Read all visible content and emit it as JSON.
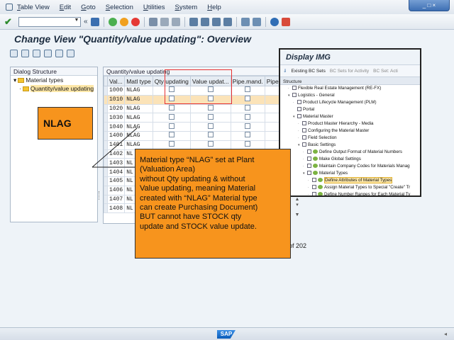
{
  "menu": [
    "Table View",
    "Edit",
    "Goto",
    "Selection",
    "Utilities",
    "System",
    "Help"
  ],
  "window_controls": "_ □ ×",
  "toolbar": {
    "back": "«",
    "dropdown": "▼"
  },
  "title": "Change View \"Quantity/value updating\": Overview",
  "dialog_structure": {
    "heading": "Dialog Structure",
    "items": [
      {
        "label": "Material types",
        "arrow": "▾"
      },
      {
        "label": "Quantity/value updating",
        "arrow": "·"
      }
    ]
  },
  "table": {
    "caption": "Quantity/value updating",
    "columns": [
      "Val...",
      "Matl type",
      "Qty updating",
      "Value updat...",
      "Pipe.mand.",
      "Pipe"
    ],
    "rows": [
      [
        "1000",
        "NLAG"
      ],
      [
        "1010",
        "NLAG"
      ],
      [
        "1020",
        "NLAG"
      ],
      [
        "1030",
        "NLAG"
      ],
      [
        "1040",
        "NLAG"
      ],
      [
        "1400",
        "NLAG"
      ],
      [
        "1401",
        "NLAG"
      ],
      [
        "1402",
        "NL"
      ],
      [
        "1403",
        "NL"
      ],
      [
        "1404",
        "NL"
      ],
      [
        "1405",
        "NL"
      ],
      [
        "1406",
        "NL"
      ],
      [
        "1407",
        "NL"
      ],
      [
        "1408",
        "NL"
      ]
    ],
    "highlight_row_index": 1,
    "count_text": "of 202"
  },
  "nlag_label": "NLAG",
  "callout": {
    "lines": [
      "Material type “NLAG” set at Plant",
      "(Valuation Area)",
      "without Qty updating & without",
      "Value updating, meaning Material",
      "created with “NLAG” Material type",
      "can create Purchasing Document)",
      "BUT cannot have STOCK qty",
      "update and STOCK value update."
    ]
  },
  "display_img": {
    "title": "Display IMG",
    "toolbar": {
      "existing_bc_sets": "Existing BC Sets",
      "bc_sets_for_activity": "BC Sets for Activity",
      "bc_sets_act": "BC Set: Acti"
    },
    "structure_heading": "Structure",
    "rows": [
      {
        "label": "Flexible Real Estate Management (RE-FX)",
        "indent": 1,
        "arrow": "·"
      },
      {
        "label": "Logistics - General",
        "indent": 1,
        "arrow": "▾"
      },
      {
        "label": "Product Lifecycle Management (PLM)",
        "indent": 2,
        "arrow": "·"
      },
      {
        "label": "Portal",
        "indent": 2,
        "arrow": ""
      },
      {
        "label": "Material Master",
        "indent": 2,
        "arrow": "▾"
      },
      {
        "label": "Product Master Hierarchy - Media",
        "indent": 3,
        "arrow": "·"
      },
      {
        "label": "Configuring the Material Master",
        "indent": 3,
        "arrow": "·"
      },
      {
        "label": "Field Selection",
        "indent": 3,
        "arrow": "·"
      },
      {
        "label": "Basic Settings",
        "indent": 3,
        "arrow": "▾"
      },
      {
        "label": "Define Output Format of Material Numbers",
        "indent": 4,
        "arrow": "·"
      },
      {
        "label": "Make Global Settings",
        "indent": 4,
        "arrow": "·"
      },
      {
        "label": "Maintain Company Codes for Materials Manag",
        "indent": 4,
        "arrow": "·"
      },
      {
        "label": "Material Types",
        "indent": 4,
        "arrow": "▾"
      },
      {
        "label": "Define Attributes of Material Types",
        "indent": 5,
        "arrow": "·",
        "highlight": true
      },
      {
        "label": "Assign Material Types to Special \"Create\" Tr",
        "indent": 5,
        "arrow": "·"
      },
      {
        "label": "Define Number Ranges for Each Material Ty",
        "indent": 5,
        "arrow": "·"
      }
    ]
  },
  "statusbar": {
    "logo": "SAP"
  },
  "colors": {
    "callout": "#f7941d",
    "highlight_box": "#e83030",
    "row_highlight": "#fbe3b8"
  }
}
